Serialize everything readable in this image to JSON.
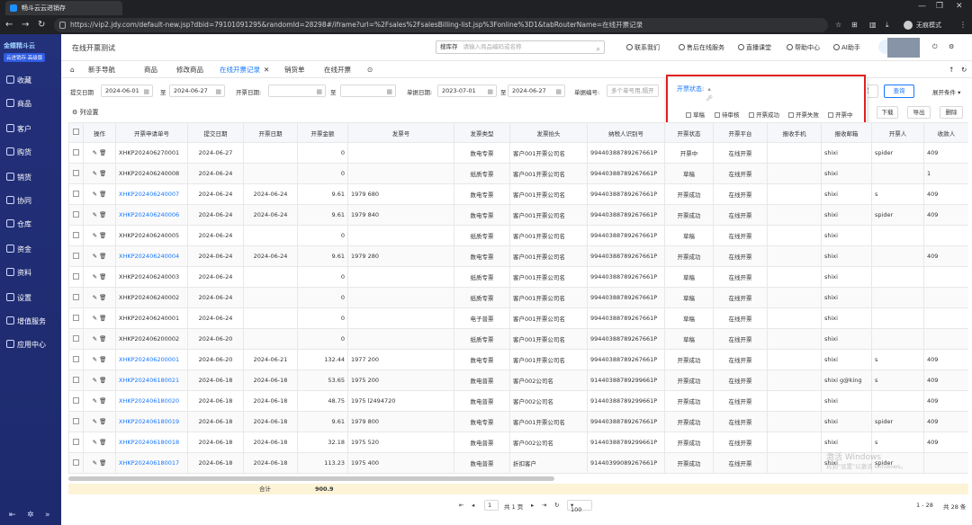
{
  "browser": {
    "tab_title": "畅斗云云进销存",
    "url": "https://vip2.jdy.com/default-new.jsp?dbid=79101091295&randomId=28298#/iframe?url=%2Fsales%2FsalesBilling-list.jsp%3Fonline%3D1&tabRouterName=在线开票记录",
    "profile": "无痕模式"
  },
  "sidebar": {
    "brand": "金蝶精斗云",
    "brand_tag": "云进销存·高级版",
    "items": [
      "收藏",
      "商品",
      "客户",
      "购货",
      "销货",
      "协同",
      "仓库",
      "资金",
      "资料",
      "设置",
      "增值服务",
      "应用中心"
    ]
  },
  "header": {
    "title": "在线开票测试",
    "search_label": "搜库存",
    "search_placeholder": "请输入商品编码或名称",
    "links": [
      "联系我们",
      "售后在线服务",
      "直播课堂",
      "帮助中心",
      "AI助手"
    ]
  },
  "tabs": [
    "新手导航",
    "商品",
    "修改商品",
    "在线开票记录",
    "销货单",
    "在线开票"
  ],
  "filters": {
    "submit_label": "提交日期",
    "submit_from": "2024-06-01",
    "to1": "至",
    "submit_to": "2024-06-27",
    "invoice_label": "开票日期:",
    "to2": "至",
    "doc_label": "单据日期:",
    "doc_from": "2023-07-01",
    "to3": "至",
    "doc_to": "2024-06-27",
    "docno_label": "单据编号:",
    "docno_placeholder": "多个单号用,隔开",
    "status_label": "开票状态:",
    "reset": "重置",
    "query": "查询",
    "expand": "展开条件"
  },
  "status_options": [
    "草稿",
    "待审核",
    "开票成功",
    "开票失败",
    "开票中"
  ],
  "toolbar": {
    "colset": "列设置",
    "download": "下载",
    "export": "导出",
    "delete": "删除"
  },
  "columns": [
    "操作",
    "开票申请单号",
    "提交日期",
    "开票日期",
    "开票金额",
    "发票号",
    "发票类型",
    "发票抬头",
    "纳税人识别号",
    "开票状态",
    "开票平台",
    "报收手机",
    "报收邮箱",
    "开票人",
    "收款人"
  ],
  "rows": [
    [
      "XHKP202406270001",
      "2024-06-27",
      "",
      "0",
      "",
      "数电专票",
      "客户001开票公司名",
      "99440388789267661P",
      "开票中",
      "在线开票",
      "",
      "shixi",
      "spider",
      "409"
    ],
    [
      "XHKP202406240008",
      "2024-06-24",
      "",
      "0",
      "",
      "纸质专票",
      "客户001开票公司名",
      "99440388789267661P",
      "草稿",
      "在线开票",
      "",
      "shixi",
      "",
      "1"
    ],
    [
      "XHKP202406240007",
      "2024-06-24",
      "2024-06-24",
      "9.61",
      "1979 680",
      "数电专票",
      "客户001开票公司名",
      "99440388789267661P",
      "开票成功",
      "在线开票",
      "",
      "shixi",
      "s",
      "409"
    ],
    [
      "XHKP202406240006",
      "2024-06-24",
      "2024-06-24",
      "9.61",
      "1979 840",
      "数电专票",
      "客户001开票公司名",
      "99440388789267661P",
      "开票成功",
      "在线开票",
      "",
      "shixi",
      "spider",
      "409"
    ],
    [
      "XHKP202406240005",
      "2024-06-24",
      "",
      "0",
      "",
      "纸质专票",
      "客户001开票公司名",
      "99440388789267661P",
      "草稿",
      "在线开票",
      "",
      "shixi",
      "",
      ""
    ],
    [
      "XHKP202406240004",
      "2024-06-24",
      "2024-06-24",
      "9.61",
      "1979 280",
      "数电专票",
      "客户001开票公司名",
      "99440388789267661P",
      "开票成功",
      "在线开票",
      "",
      "shixi",
      "",
      "409"
    ],
    [
      "XHKP202406240003",
      "2024-06-24",
      "",
      "0",
      "",
      "纸质专票",
      "客户001开票公司名",
      "99440388789267661P",
      "草稿",
      "在线开票",
      "",
      "shixi",
      "",
      ""
    ],
    [
      "XHKP202406240002",
      "2024-06-24",
      "",
      "0",
      "",
      "纸质专票",
      "客户001开票公司名",
      "99440388789267661P",
      "草稿",
      "在线开票",
      "",
      "shixi",
      "",
      ""
    ],
    [
      "XHKP202406240001",
      "2024-06-24",
      "",
      "0",
      "",
      "电子普票",
      "客户001开票公司名",
      "99440388789267661P",
      "草稿",
      "在线开票",
      "",
      "shixi",
      "",
      ""
    ],
    [
      "XHKP202406200002",
      "2024-06-20",
      "",
      "0",
      "",
      "纸质专票",
      "客户001开票公司名",
      "99440388789267661P",
      "草稿",
      "在线开票",
      "",
      "shixi",
      "",
      ""
    ],
    [
      "XHKP202406200001",
      "2024-06-20",
      "2024-06-21",
      "132.44",
      "1977 200",
      "数电专票",
      "客户001开票公司名",
      "99440388789267661P",
      "开票成功",
      "在线开票",
      "",
      "shixi",
      "s",
      "409"
    ],
    [
      "XHKP202406180021",
      "2024-06-18",
      "2024-06-18",
      "53.65",
      "1975 200",
      "数电普票",
      "客户002公司名",
      "91440388789299661P",
      "开票成功",
      "在线开票",
      "",
      "shixi g@king",
      "s",
      "409"
    ],
    [
      "XHKP202406180020",
      "2024-06-18",
      "2024-06-18",
      "48.75",
      "1975 l2494720",
      "数电普票",
      "客户002公司名",
      "91440388789299661P",
      "开票成功",
      "在线开票",
      "",
      "shixi",
      "",
      "409"
    ],
    [
      "XHKP202406180019",
      "2024-06-18",
      "2024-06-18",
      "9.61",
      "1979 800",
      "数电专票",
      "客户001开票公司名",
      "99440388789267661P",
      "开票成功",
      "在线开票",
      "",
      "shixi",
      "spider",
      "409"
    ],
    [
      "XHKP202406180018",
      "2024-06-18",
      "2024-06-18",
      "32.18",
      "1975 520",
      "数电普票",
      "客户002公司名",
      "91440388789299661P",
      "开票成功",
      "在线开票",
      "",
      "shixi",
      "s",
      "409"
    ],
    [
      "XHKP202406180017",
      "2024-06-18",
      "2024-06-18",
      "113.23",
      "1975 400",
      "数电普票",
      "折扣客户",
      "91440399089267661P",
      "开票成功",
      "在线开票",
      "",
      "shixi",
      "spider",
      ""
    ]
  ],
  "summary": {
    "label": "合计",
    "total": "900.9"
  },
  "pager": {
    "page": "1",
    "of": "共 1 页",
    "size": "100",
    "range": "1 - 28",
    "total": "共 28 条"
  },
  "watermark": {
    "line1": "激活 Windows",
    "line2": "转到\"设置\"以激活 Windows。"
  }
}
